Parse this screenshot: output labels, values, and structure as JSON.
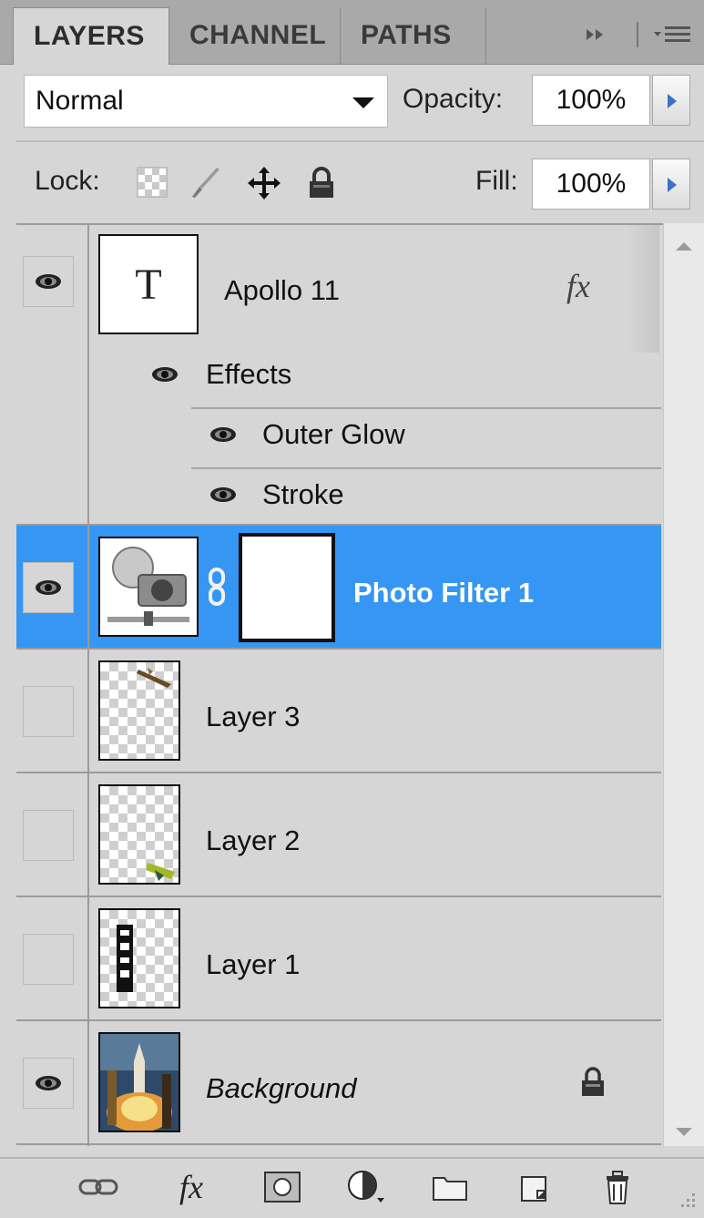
{
  "tabs": [
    {
      "label": "LAYERS"
    },
    {
      "label": "CHANNEL"
    },
    {
      "label": "PATHS"
    }
  ],
  "tab_controls": {
    "expand_icon": "double-chevron-right-icon",
    "menu_icon": "panel-menu-icon"
  },
  "blend": {
    "mode": "Normal",
    "opacity_label": "Opacity:",
    "opacity_value": "100%"
  },
  "lock": {
    "label": "Lock:",
    "fill_label": "Fill:",
    "fill_value": "100%",
    "icons": [
      "lock-transparent-icon",
      "lock-image-icon",
      "lock-position-icon",
      "lock-all-icon"
    ]
  },
  "layers": [
    {
      "name": "Apollo 11",
      "type": "text",
      "visible": true,
      "fx_label": "fx",
      "thumb_letter": "T",
      "effects_label": "Effects",
      "effects": [
        {
          "name": "Outer Glow"
        },
        {
          "name": "Stroke"
        }
      ]
    },
    {
      "name": "Photo Filter 1",
      "type": "adjustment",
      "visible": true,
      "selected": true
    },
    {
      "name": "Layer 3",
      "type": "pixel",
      "visible": false
    },
    {
      "name": "Layer 2",
      "type": "pixel",
      "visible": false
    },
    {
      "name": "Layer 1",
      "type": "pixel",
      "visible": false
    },
    {
      "name": "Background",
      "type": "background",
      "visible": true,
      "locked": true
    }
  ],
  "toolbar": {
    "fx_label": "fx",
    "icons": [
      "link-layers-icon",
      "add-style-icon",
      "add-mask-icon",
      "new-adjustment-icon",
      "new-group-icon",
      "new-layer-icon",
      "delete-layer-icon"
    ]
  },
  "colors": {
    "selection": "#3596f4",
    "panel": "#d6d6d6",
    "tab_bar": "#a9a9a9"
  }
}
